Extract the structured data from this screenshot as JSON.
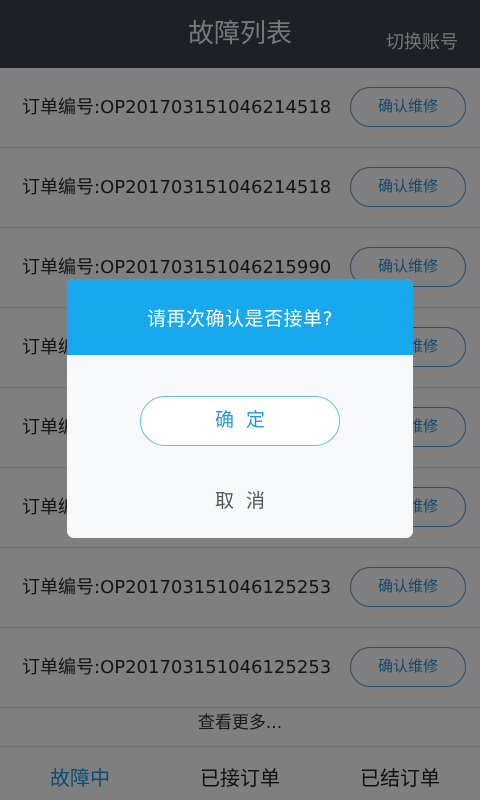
{
  "header": {
    "title": "故障列表",
    "switch_account": "切换账号"
  },
  "orders": [
    {
      "label": "订单编号:OP20170315104621451​8",
      "button": "确认维修"
    },
    {
      "label": "订单编号:OP20170315104621451​8",
      "button": "确认维修"
    },
    {
      "label": "订单编号:OP20170315104621599​0",
      "button": "确认维修"
    },
    {
      "label": "订单编",
      "button": "确认维修"
    },
    {
      "label": "订单编",
      "button": "确认维修"
    },
    {
      "label": "订单编",
      "button": "确认维修"
    },
    {
      "label": "订单编号:OP20170315104612525​3",
      "button": "确认维修"
    },
    {
      "label": "订单编号:OP20170315104612525​3",
      "button": "确认维修"
    }
  ],
  "more": "查看更多...",
  "tabs": [
    {
      "label": "故障中",
      "active": true
    },
    {
      "label": "已接订单",
      "active": false
    },
    {
      "label": "已结订单",
      "active": false
    }
  ],
  "dialog": {
    "title": "请再次确认是否接单?",
    "confirm": "确定",
    "cancel": "取消"
  },
  "colors": {
    "header_bg": "#3a4048",
    "accent": "#18a8ee",
    "active_tab": "#1a9be0"
  }
}
